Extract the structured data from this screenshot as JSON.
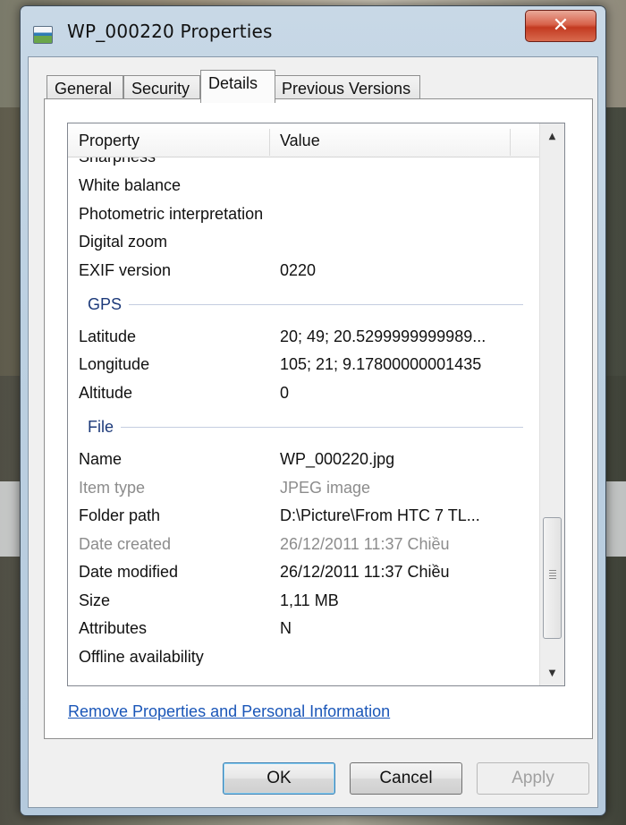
{
  "window": {
    "title": "WP_000220 Properties",
    "close_glyph": "✕"
  },
  "tabs": [
    {
      "label": "General",
      "active": false
    },
    {
      "label": "Security",
      "active": false
    },
    {
      "label": "Details",
      "active": true
    },
    {
      "label": "Previous Versions",
      "active": false
    }
  ],
  "list": {
    "headers": {
      "property": "Property",
      "value": "Value"
    },
    "clipped_row": {
      "property": "Sharpness",
      "value": ""
    },
    "rows_a": [
      {
        "property": "White balance",
        "value": "",
        "dim": false
      },
      {
        "property": "Photometric interpretation",
        "value": "",
        "dim": false
      },
      {
        "property": "Digital zoom",
        "value": "",
        "dim": false
      },
      {
        "property": "EXIF version",
        "value": "0220",
        "dim": false
      }
    ],
    "group_gps": "GPS",
    "rows_gps": [
      {
        "property": "Latitude",
        "value": "20; 49; 20.5299999999989...",
        "dim": false
      },
      {
        "property": "Longitude",
        "value": "105; 21; 9.17800000001435",
        "dim": false
      },
      {
        "property": "Altitude",
        "value": "0",
        "dim": false
      }
    ],
    "group_file": "File",
    "rows_file": [
      {
        "property": "Name",
        "value": "WP_000220.jpg",
        "dim": false
      },
      {
        "property": "Item type",
        "value": "JPEG image",
        "dim": true
      },
      {
        "property": "Folder path",
        "value": "D:\\Picture\\From HTC 7 TL...",
        "dim": false
      },
      {
        "property": "Date created",
        "value": "26/12/2011 11:37 Chiều",
        "dim": true
      },
      {
        "property": "Date modified",
        "value": "26/12/2011 11:37 Chiều",
        "dim": false
      },
      {
        "property": "Size",
        "value": "1,11 MB",
        "dim": false
      },
      {
        "property": "Attributes",
        "value": "N",
        "dim": false
      },
      {
        "property": "Offline availability",
        "value": "",
        "dim": false
      }
    ]
  },
  "link": "Remove Properties and Personal Information",
  "buttons": {
    "ok": "OK",
    "cancel": "Cancel",
    "apply": "Apply"
  },
  "colors": {
    "link": "#1a56b8",
    "group_header": "#1d3a7a",
    "close_button": "#c33a21"
  }
}
